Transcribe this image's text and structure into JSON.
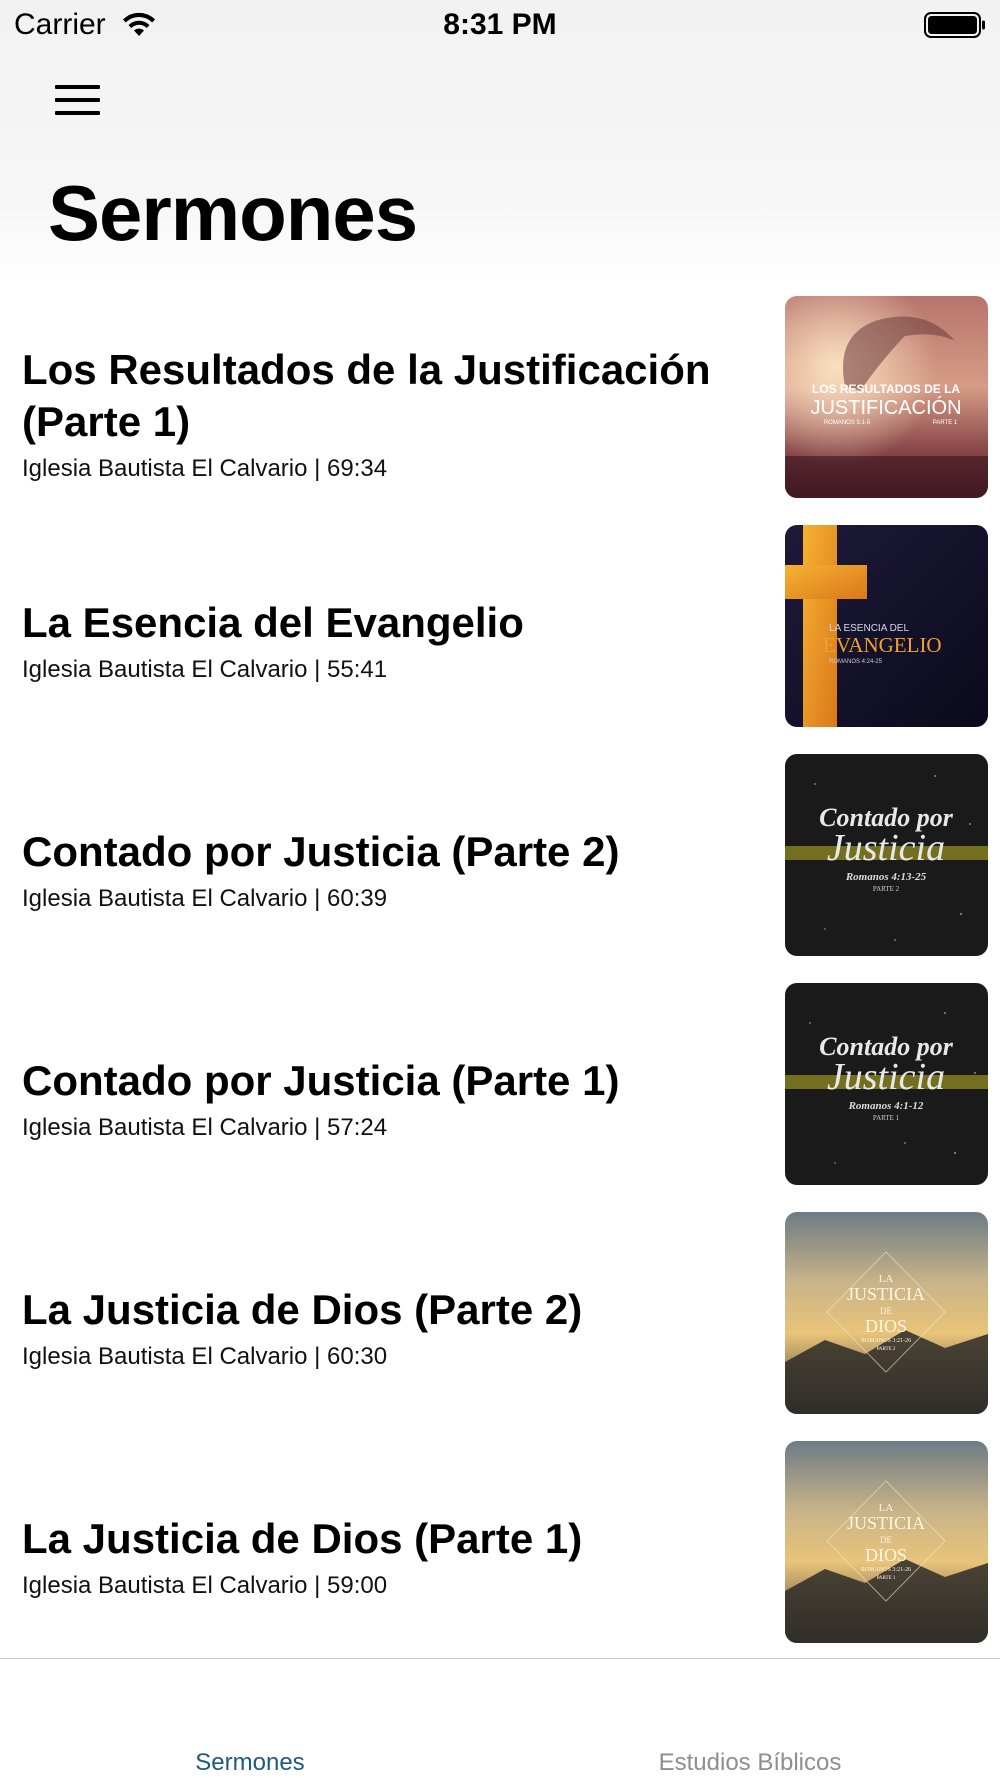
{
  "status_bar": {
    "carrier": "Carrier",
    "time": "8:31 PM",
    "wifi_icon": "wifi-icon",
    "battery_icon": "battery-icon"
  },
  "nav": {
    "menu_icon": "hamburger-menu-icon",
    "title": "Sermones"
  },
  "sermons": [
    {
      "title": "Los Resultados de la Justificación (Parte 1)",
      "subtitle": "Iglesia Bautista El Calvario | 69:34",
      "thumbnail": {
        "lines": [
          "LOS RESULTADOS DE LA",
          "JUSTIFICACIÓN",
          "ROMANOS 5:1-5",
          "PARTE 1"
        ]
      }
    },
    {
      "title": "La Esencia del Evangelio",
      "subtitle": "Iglesia Bautista El Calvario | 55:41",
      "thumbnail": {
        "lines": [
          "LA ESENCIA DEL",
          "EVANGELIO",
          "ROMANOS 4:24-25"
        ]
      }
    },
    {
      "title": "Contado por Justicia (Parte 2)",
      "subtitle": "Iglesia Bautista El Calvario | 60:39",
      "thumbnail": {
        "lines": [
          "Contado por",
          "Justicia",
          "Romanos 4:13-25",
          "PARTE 2"
        ]
      }
    },
    {
      "title": "Contado por Justicia (Parte 1)",
      "subtitle": "Iglesia Bautista El Calvario | 57:24",
      "thumbnail": {
        "lines": [
          "Contado por",
          "Justicia",
          "Romanos 4:1-12",
          "PARTE 1"
        ]
      }
    },
    {
      "title": "La Justicia de Dios (Parte 2)",
      "subtitle": "Iglesia Bautista El Calvario | 60:30",
      "thumbnail": {
        "lines": [
          "LA",
          "JUSTICIA",
          "DE",
          "DIOS",
          "ROMANOS 3:21-26",
          "PARTE 2"
        ]
      }
    },
    {
      "title": "La Justicia de Dios (Parte 1)",
      "subtitle": "Iglesia Bautista El Calvario | 59:00",
      "thumbnail": {
        "lines": [
          "LA",
          "JUSTICIA",
          "DE",
          "DIOS",
          "ROMANOS 3:21-26",
          "PARTE 1"
        ]
      }
    }
  ],
  "tabbar": {
    "tabs": [
      {
        "label": "Sermones",
        "active": true
      },
      {
        "label": "Estudios Bíblicos",
        "active": false
      }
    ],
    "active_color": "#1f5a7c",
    "inactive_color": "#8e8e93"
  }
}
